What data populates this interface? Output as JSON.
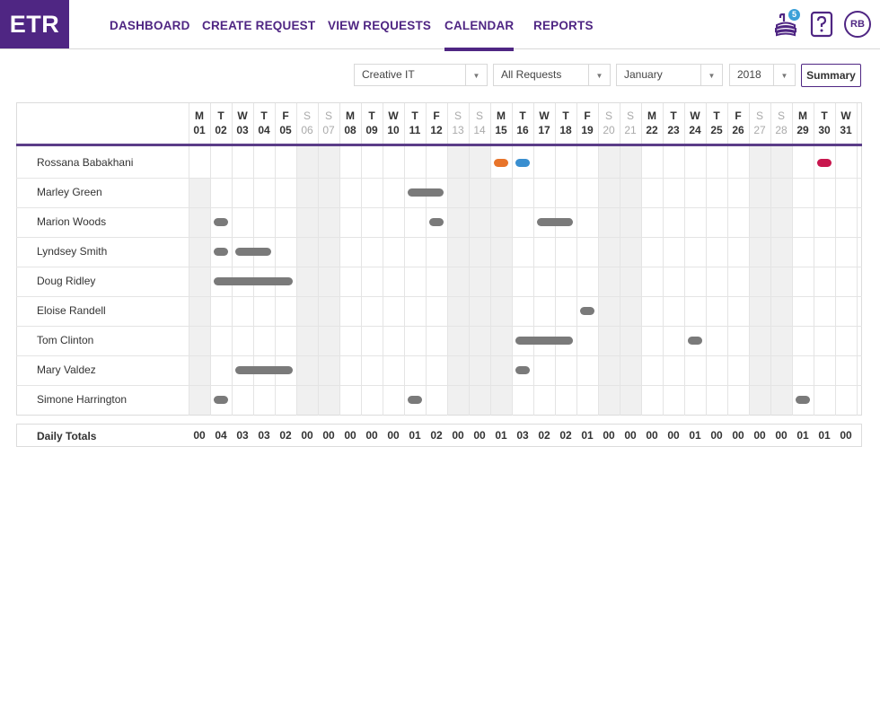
{
  "app": {
    "logo": "ETR"
  },
  "nav": [
    {
      "label": "DASHBOARD",
      "active": false
    },
    {
      "label": "CREATE REQUEST",
      "active": false
    },
    {
      "label": "VIEW REQUESTS",
      "active": false
    },
    {
      "label": "CALENDAR",
      "active": true
    },
    {
      "label": "REPORTS",
      "active": false
    }
  ],
  "header": {
    "notification_count": "5",
    "help_icon": "help-icon",
    "user_initials": "RB"
  },
  "filters": {
    "department": "Creative IT",
    "request_type": "All Requests",
    "month": "January",
    "year": "2018",
    "summary_label": "Summary"
  },
  "calendar": {
    "days": [
      {
        "dow": "M",
        "date": "01",
        "weekend": false
      },
      {
        "dow": "T",
        "date": "02",
        "weekend": false
      },
      {
        "dow": "W",
        "date": "03",
        "weekend": false
      },
      {
        "dow": "T",
        "date": "04",
        "weekend": false
      },
      {
        "dow": "F",
        "date": "05",
        "weekend": false
      },
      {
        "dow": "S",
        "date": "06",
        "weekend": true
      },
      {
        "dow": "S",
        "date": "07",
        "weekend": true
      },
      {
        "dow": "M",
        "date": "08",
        "weekend": false
      },
      {
        "dow": "T",
        "date": "09",
        "weekend": false
      },
      {
        "dow": "W",
        "date": "10",
        "weekend": false
      },
      {
        "dow": "T",
        "date": "11",
        "weekend": false
      },
      {
        "dow": "F",
        "date": "12",
        "weekend": false
      },
      {
        "dow": "S",
        "date": "13",
        "weekend": true
      },
      {
        "dow": "S",
        "date": "14",
        "weekend": true
      },
      {
        "dow": "M",
        "date": "15",
        "weekend": false
      },
      {
        "dow": "T",
        "date": "16",
        "weekend": false
      },
      {
        "dow": "W",
        "date": "17",
        "weekend": false
      },
      {
        "dow": "T",
        "date": "18",
        "weekend": false
      },
      {
        "dow": "F",
        "date": "19",
        "weekend": false
      },
      {
        "dow": "S",
        "date": "20",
        "weekend": true
      },
      {
        "dow": "S",
        "date": "21",
        "weekend": true
      },
      {
        "dow": "M",
        "date": "22",
        "weekend": false
      },
      {
        "dow": "T",
        "date": "23",
        "weekend": false
      },
      {
        "dow": "W",
        "date": "24",
        "weekend": false
      },
      {
        "dow": "T",
        "date": "25",
        "weekend": false
      },
      {
        "dow": "F",
        "date": "26",
        "weekend": false
      },
      {
        "dow": "S",
        "date": "27",
        "weekend": true
      },
      {
        "dow": "S",
        "date": "28",
        "weekend": true
      },
      {
        "dow": "M",
        "date": "29",
        "weekend": false
      },
      {
        "dow": "T",
        "date": "30",
        "weekend": false
      },
      {
        "dow": "W",
        "date": "31",
        "weekend": false
      }
    ],
    "holiday_day": 15,
    "rows": [
      {
        "name": "Rossana Babakhani",
        "blocks_off": false,
        "requests": [
          {
            "start": 15,
            "end": 15,
            "color": "#e8742a"
          },
          {
            "start": 16,
            "end": 16,
            "color": "#3a8fd0"
          },
          {
            "start": 30,
            "end": 30,
            "color": "#c8174e"
          }
        ]
      },
      {
        "name": "Marley Green",
        "blocks_off": true,
        "requests": [
          {
            "start": 11,
            "end": 12,
            "color": "#7a7a7a"
          }
        ]
      },
      {
        "name": "Marion Woods",
        "blocks_off": true,
        "requests": [
          {
            "start": 2,
            "end": 2,
            "color": "#7a7a7a"
          },
          {
            "start": 12,
            "end": 12,
            "color": "#7a7a7a"
          },
          {
            "start": 17,
            "end": 18,
            "color": "#7a7a7a"
          }
        ]
      },
      {
        "name": "Lyndsey Smith",
        "blocks_off": true,
        "requests": [
          {
            "start": 2,
            "end": 2,
            "color": "#7a7a7a"
          },
          {
            "start": 3,
            "end": 4,
            "color": "#7a7a7a"
          }
        ]
      },
      {
        "name": "Doug Ridley",
        "blocks_off": true,
        "requests": [
          {
            "start": 2,
            "end": 5,
            "color": "#7a7a7a"
          }
        ]
      },
      {
        "name": "Eloise Randell",
        "blocks_off": true,
        "requests": [
          {
            "start": 19,
            "end": 19,
            "color": "#7a7a7a"
          }
        ]
      },
      {
        "name": "Tom Clinton",
        "blocks_off": true,
        "requests": [
          {
            "start": 16,
            "end": 18,
            "color": "#7a7a7a"
          },
          {
            "start": 24,
            "end": 24,
            "color": "#7a7a7a"
          }
        ]
      },
      {
        "name": "Mary Valdez",
        "blocks_off": true,
        "requests": [
          {
            "start": 3,
            "end": 5,
            "color": "#7a7a7a"
          },
          {
            "start": 16,
            "end": 16,
            "color": "#7a7a7a"
          }
        ]
      },
      {
        "name": "Simone Harrington",
        "blocks_off": true,
        "requests": [
          {
            "start": 2,
            "end": 2,
            "color": "#7a7a7a"
          },
          {
            "start": 11,
            "end": 11,
            "color": "#7a7a7a"
          },
          {
            "start": 29,
            "end": 29,
            "color": "#7a7a7a"
          }
        ]
      }
    ],
    "totals_label": "Daily Totals",
    "totals": [
      "00",
      "04",
      "03",
      "03",
      "02",
      "00",
      "00",
      "00",
      "00",
      "00",
      "01",
      "02",
      "00",
      "00",
      "01",
      "03",
      "02",
      "02",
      "01",
      "00",
      "00",
      "00",
      "00",
      "01",
      "00",
      "00",
      "00",
      "00",
      "01",
      "01",
      "00"
    ]
  },
  "colors": {
    "brand": "#4f2683",
    "accent_blue": "#3aa0d8",
    "grey_bar": "#7a7a7a"
  }
}
